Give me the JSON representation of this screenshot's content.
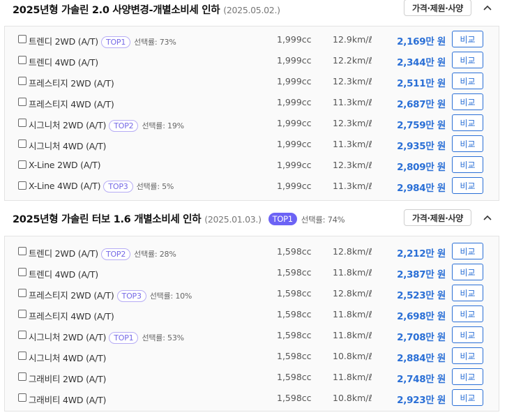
{
  "sections": [
    {
      "title": "2025년형 가솔린 2.0 사양변경-개별소비세 인하",
      "date": "(2025.05.02.)",
      "header_badge": "",
      "header_rate": "",
      "spec_button": "가격·제원·사양",
      "collapse_icon": "chevron-up-icon",
      "rows": [
        {
          "name": "트렌디 2WD (A/T)",
          "badge": "TOP1",
          "rate": "선택률: 73%",
          "cc": "1,999cc",
          "eff": "12.9km/ℓ",
          "price": "2,169만 원",
          "cmp": "비교"
        },
        {
          "name": "트렌디 4WD (A/T)",
          "badge": "",
          "rate": "",
          "cc": "1,999cc",
          "eff": "12.2km/ℓ",
          "price": "2,344만 원",
          "cmp": "비교"
        },
        {
          "name": "프레스티지 2WD (A/T)",
          "badge": "",
          "rate": "",
          "cc": "1,999cc",
          "eff": "12.3km/ℓ",
          "price": "2,511만 원",
          "cmp": "비교"
        },
        {
          "name": "프레스티지 4WD (A/T)",
          "badge": "",
          "rate": "",
          "cc": "1,999cc",
          "eff": "11.3km/ℓ",
          "price": "2,687만 원",
          "cmp": "비교"
        },
        {
          "name": "시그니처 2WD (A/T)",
          "badge": "TOP2",
          "rate": "선택률: 19%",
          "cc": "1,999cc",
          "eff": "12.3km/ℓ",
          "price": "2,759만 원",
          "cmp": "비교"
        },
        {
          "name": "시그니처 4WD (A/T)",
          "badge": "",
          "rate": "",
          "cc": "1,999cc",
          "eff": "11.3km/ℓ",
          "price": "2,935만 원",
          "cmp": "비교"
        },
        {
          "name": "X-Line 2WD (A/T)",
          "badge": "",
          "rate": "",
          "cc": "1,999cc",
          "eff": "12.3km/ℓ",
          "price": "2,809만 원",
          "cmp": "비교"
        },
        {
          "name": "X-Line 4WD (A/T)",
          "badge": "TOP3",
          "rate": "선택률: 5%",
          "cc": "1,999cc",
          "eff": "11.3km/ℓ",
          "price": "2,984만 원",
          "cmp": "비교"
        }
      ]
    },
    {
      "title": "2025년형 가솔린 터보 1.6 개별소비세 인하",
      "date": "(2025.01.03.)",
      "header_badge": "TOP1",
      "header_rate": "선택률: 74%",
      "spec_button": "가격·제원·사양",
      "collapse_icon": "chevron-up-icon",
      "rows": [
        {
          "name": "트렌디 2WD (A/T)",
          "badge": "TOP2",
          "rate": "선택률: 28%",
          "cc": "1,598cc",
          "eff": "12.8km/ℓ",
          "price": "2,212만 원",
          "cmp": "비교"
        },
        {
          "name": "트렌디 4WD (A/T)",
          "badge": "",
          "rate": "",
          "cc": "1,598cc",
          "eff": "11.8km/ℓ",
          "price": "2,387만 원",
          "cmp": "비교"
        },
        {
          "name": "프레스티지 2WD (A/T)",
          "badge": "TOP3",
          "rate": "선택률: 10%",
          "cc": "1,598cc",
          "eff": "12.8km/ℓ",
          "price": "2,523만 원",
          "cmp": "비교"
        },
        {
          "name": "프레스티지 4WD (A/T)",
          "badge": "",
          "rate": "",
          "cc": "1,598cc",
          "eff": "11.8km/ℓ",
          "price": "2,698만 원",
          "cmp": "비교"
        },
        {
          "name": "시그니처 2WD (A/T)",
          "badge": "TOP1",
          "rate": "선택률: 53%",
          "cc": "1,598cc",
          "eff": "11.8km/ℓ",
          "price": "2,708만 원",
          "cmp": "비교"
        },
        {
          "name": "시그니처 4WD (A/T)",
          "badge": "",
          "rate": "",
          "cc": "1,598cc",
          "eff": "10.8km/ℓ",
          "price": "2,884만 원",
          "cmp": "비교"
        },
        {
          "name": "그래비티 2WD (A/T)",
          "badge": "",
          "rate": "",
          "cc": "1,598cc",
          "eff": "11.8km/ℓ",
          "price": "2,748만 원",
          "cmp": "비교"
        },
        {
          "name": "그래비티 4WD (A/T)",
          "badge": "",
          "rate": "",
          "cc": "1,598cc",
          "eff": "10.8km/ℓ",
          "price": "2,923만 원",
          "cmp": "비교"
        }
      ]
    }
  ],
  "colors": {
    "accent": "#2a6fd6",
    "badge_fill": "#6c63f5",
    "badge_outline": "#b6acf5"
  }
}
